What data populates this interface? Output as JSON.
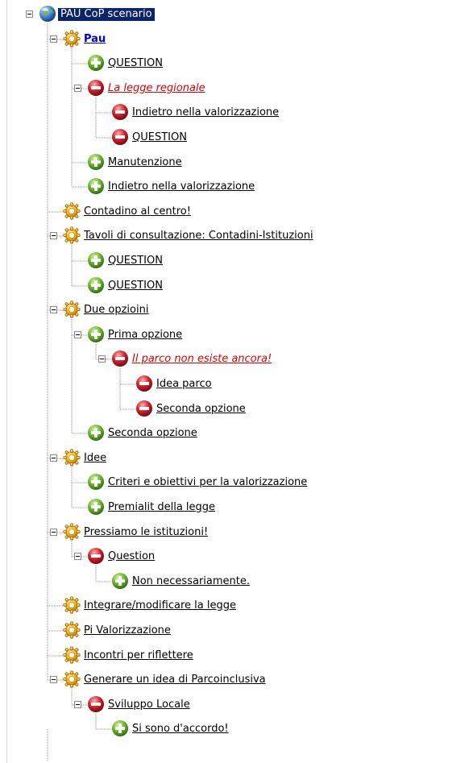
{
  "tree": {
    "root": {
      "label": "PAU CoP scenario",
      "kind": "globe"
    },
    "nodes": [
      {
        "label": "Pau",
        "kind": "issue",
        "depth": 1,
        "expander": true,
        "style": "sel"
      },
      {
        "label": "QUESTION",
        "kind": "pos",
        "depth": 2
      },
      {
        "label": "La legge regionale",
        "kind": "neg",
        "depth": 2,
        "expander": true,
        "style": "hot"
      },
      {
        "label": "Indietro nella valorizzazione",
        "kind": "neg",
        "depth": 3
      },
      {
        "label": "QUESTION",
        "kind": "neg",
        "depth": 3
      },
      {
        "label": "Manutenzione",
        "kind": "pos",
        "depth": 2
      },
      {
        "label": "Indietro nella valorizzazione",
        "kind": "pos",
        "depth": 2
      },
      {
        "label": "Contadino al centro!",
        "kind": "issue",
        "depth": 1
      },
      {
        "label": "Tavoli di consultazione: Contadini-Istituzioni",
        "kind": "issue",
        "depth": 1,
        "expander": true
      },
      {
        "label": "QUESTION",
        "kind": "pos",
        "depth": 2
      },
      {
        "label": "QUESTION",
        "kind": "pos",
        "depth": 2
      },
      {
        "label": "Due opzioini",
        "kind": "issue",
        "depth": 1,
        "expander": true
      },
      {
        "label": "Prima opzione",
        "kind": "pos",
        "depth": 2,
        "expander": true
      },
      {
        "label": "Il parco non esiste ancora!",
        "kind": "neg",
        "depth": 3,
        "expander": true,
        "style": "hot"
      },
      {
        "label": "Idea parco",
        "kind": "neg",
        "depth": 4
      },
      {
        "label": "Seconda opzione",
        "kind": "neg",
        "depth": 4
      },
      {
        "label": "Seconda opzione",
        "kind": "pos",
        "depth": 2
      },
      {
        "label": "Idee",
        "kind": "issue",
        "depth": 1,
        "expander": true
      },
      {
        "label": "Criteri e obiettivi per la valorizzazione",
        "kind": "pos",
        "depth": 2
      },
      {
        "label": "Premialit della legge",
        "kind": "pos",
        "depth": 2
      },
      {
        "label": "Pressiamo le istituzioni!",
        "kind": "issue",
        "depth": 1,
        "expander": true
      },
      {
        "label": "Question",
        "kind": "neg",
        "depth": 2,
        "expander": true
      },
      {
        "label": "Non necessariamente.",
        "kind": "pos",
        "depth": 3
      },
      {
        "label": "Integrare/modificare la legge",
        "kind": "issue",
        "depth": 1
      },
      {
        "label": "Pi Valorizzazione",
        "kind": "issue",
        "depth": 1
      },
      {
        "label": "Incontri per riflettere",
        "kind": "issue",
        "depth": 1
      },
      {
        "label": "Generare un idea di Parcoinclusiva",
        "kind": "issue",
        "depth": 1,
        "expander": true
      },
      {
        "label": "Sviluppo Locale",
        "kind": "neg",
        "depth": 2,
        "expander": true
      },
      {
        "label": "Si sono d'accordo!",
        "kind": "pos",
        "depth": 3
      }
    ]
  },
  "colors": {
    "selection": "#0a246a",
    "hot_label": "#e00000",
    "position_icon": "#5aa321",
    "negative_icon": "#c8182a",
    "issue_icon": "#f0a820"
  },
  "icons": {
    "root": "globe-icon",
    "issue": "gear-icon",
    "pos": "plus-circle-icon",
    "neg": "minus-circle-icon"
  }
}
